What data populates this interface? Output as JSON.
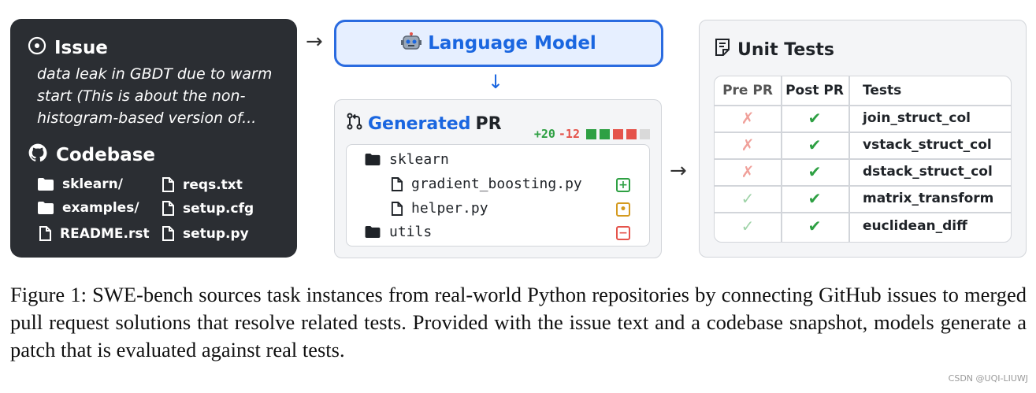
{
  "issue": {
    "title": "Issue",
    "text": "data leak in GBDT due to warm start (This is about the non-histogram-based version of..."
  },
  "codebase": {
    "title": "Codebase",
    "items": [
      {
        "name": "sklearn/",
        "icon": "folder-icon"
      },
      {
        "name": "reqs.txt",
        "icon": "file-icon"
      },
      {
        "name": "examples/",
        "icon": "folder-icon"
      },
      {
        "name": "setup.cfg",
        "icon": "file-icon"
      },
      {
        "name": "README.rst",
        "icon": "file-icon"
      },
      {
        "name": "setup.py",
        "icon": "file-icon"
      }
    ]
  },
  "language_model": {
    "label": "Language Model",
    "icon": "robot-icon"
  },
  "generated_pr": {
    "title_part1": "Generated",
    "title_part2": "PR",
    "additions": "+20",
    "deletions": "-12",
    "diff_blocks": [
      "#2ea043",
      "#2ea043",
      "#e5534b",
      "#e5534b",
      "#d9d9d9"
    ],
    "tree": [
      {
        "name": "sklearn",
        "type": "folder",
        "status": ""
      },
      {
        "name": "gradient_boosting.py",
        "type": "file",
        "status": "added"
      },
      {
        "name": "helper.py",
        "type": "file",
        "status": "modified"
      },
      {
        "name": "utils",
        "type": "folder",
        "status": "removed"
      }
    ],
    "status_colors": {
      "added": "#2ea043",
      "modified": "#d49a1f",
      "removed": "#e5534b"
    }
  },
  "unit_tests": {
    "title": "Unit Tests",
    "headers": [
      "Pre PR",
      "Post PR",
      "Tests"
    ],
    "rows": [
      {
        "pre": "fail",
        "post": "pass",
        "test": "join_struct_col"
      },
      {
        "pre": "fail",
        "post": "pass",
        "test": "vstack_struct_col"
      },
      {
        "pre": "fail",
        "post": "pass",
        "test": "dstack_struct_col"
      },
      {
        "pre": "pass",
        "post": "pass",
        "test": "matrix_transform"
      },
      {
        "pre": "pass",
        "post": "pass",
        "test": "euclidean_diff"
      }
    ],
    "colors": {
      "pre_fail": "#f0a09a",
      "pre_pass": "#9fd3a8",
      "post_pass": "#2ea043"
    }
  },
  "caption": "Figure 1: SWE-bench sources task instances from real-world Python repositories by connecting GitHub issues to merged pull request solutions that resolve related tests. Provided with the issue text and a codebase snapshot, models generate a patch that is evaluated against real tests.",
  "watermark": "CSDN @UQI-LIUWJ"
}
